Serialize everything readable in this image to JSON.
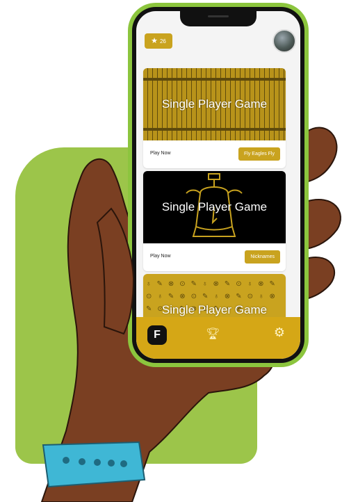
{
  "header": {
    "score": "26",
    "score_icon": "star-icon",
    "avatar": "user-avatar"
  },
  "cards": [
    {
      "title": "Single Player Game",
      "play_label": "Play Now",
      "tag": "Fly Eagles Fly"
    },
    {
      "title": "Single Player Game",
      "play_label": "Play Now",
      "tag": "Nicknames"
    },
    {
      "title": "Single Player Game"
    }
  ],
  "nav": {
    "items": [
      "home-icon",
      "trophy-icon",
      "gear-icon"
    ]
  },
  "colors": {
    "accent": "#c9a31f",
    "phone_frame": "#8cc53e",
    "background_shape": "#9cc54a",
    "skin": "#7a3f22",
    "wristband": "#3fb7d5"
  }
}
